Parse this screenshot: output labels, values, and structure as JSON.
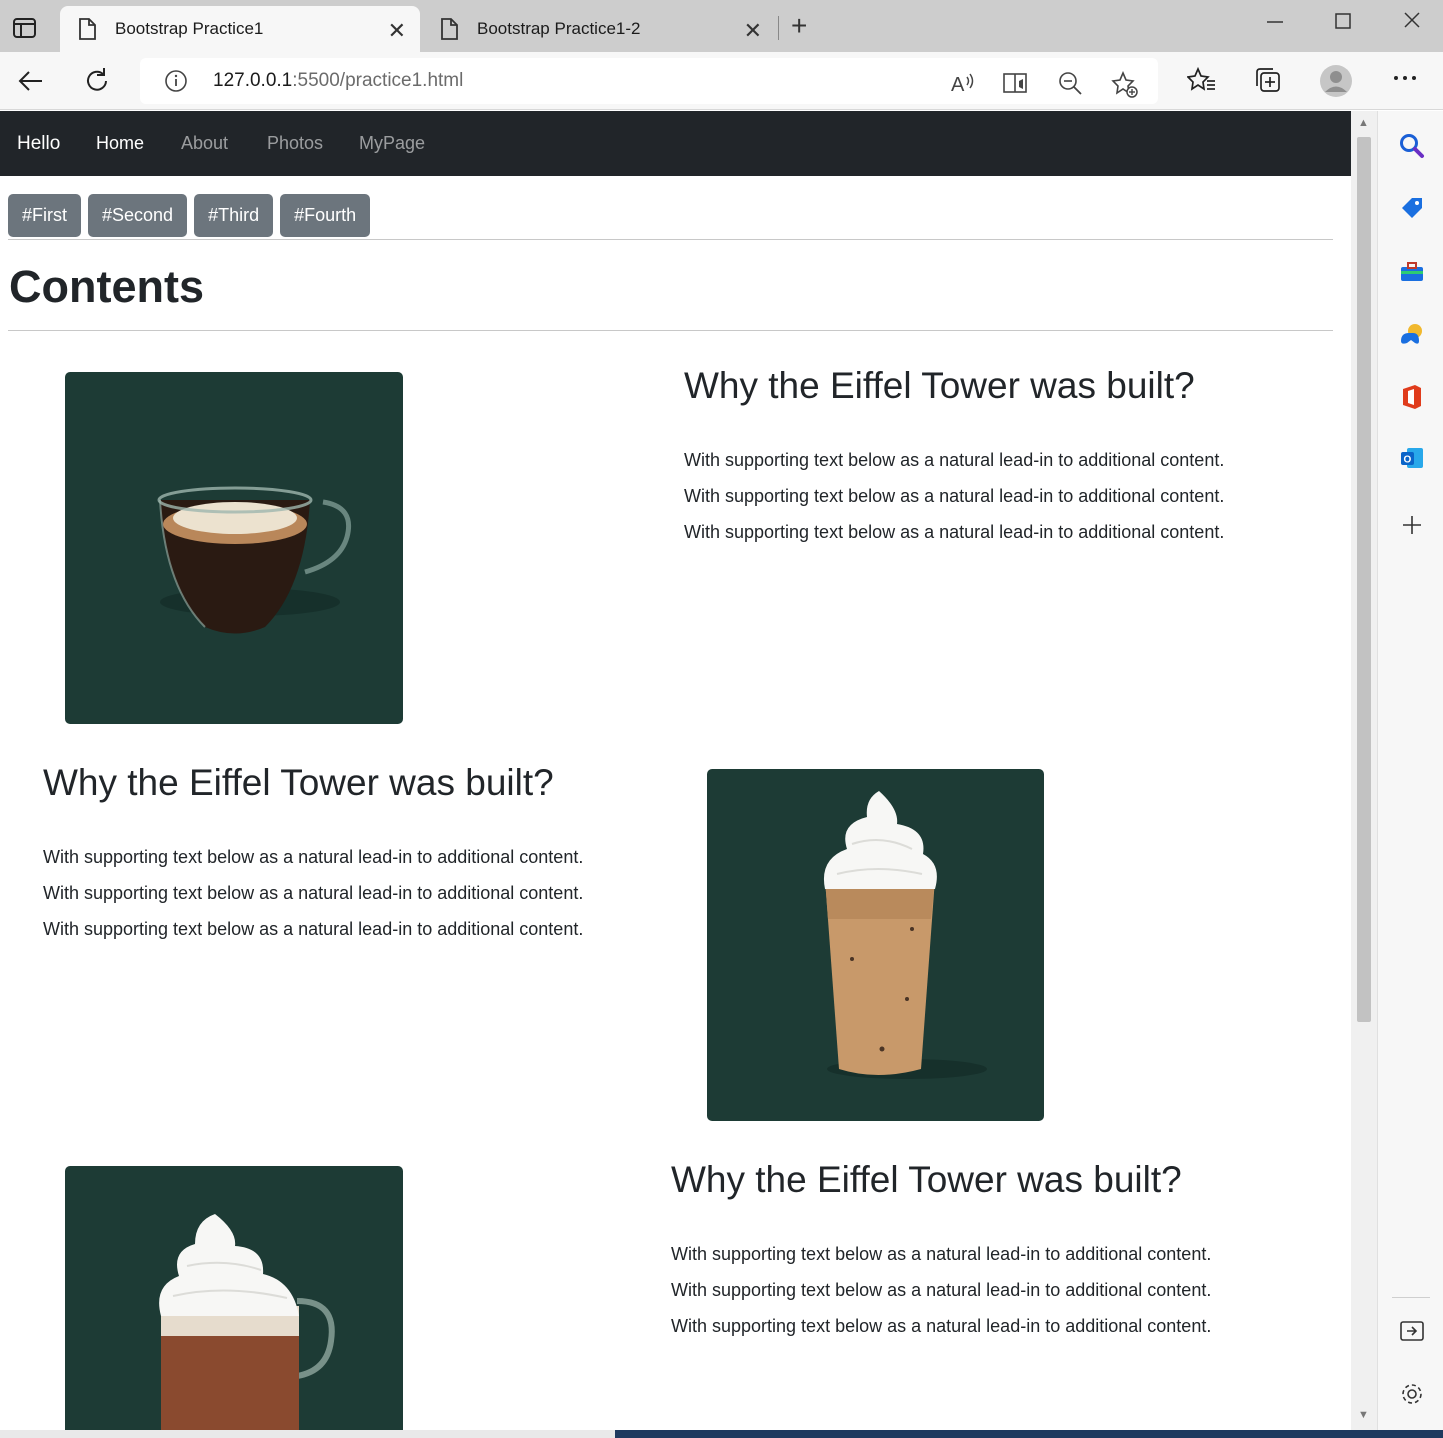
{
  "browser": {
    "tabs": [
      {
        "title": "Bootstrap Practice1",
        "active": true
      },
      {
        "title": "Bootstrap Practice1-2",
        "active": false
      }
    ],
    "url_host": "127.0.0.1",
    "url_rest": ":5500/practice1.html"
  },
  "navbar": {
    "brand": "Hello",
    "links": [
      "Home",
      "About",
      "Photos",
      "MyPage"
    ]
  },
  "buttons": [
    "#First",
    "#Second",
    "#Third",
    "#Fourth"
  ],
  "contents_title": "Contents",
  "sections": [
    {
      "heading": "Why the Eiffel Tower was built?",
      "lines": [
        "With supporting text below as a natural lead-in to additional content.",
        "With supporting text below as a natural lead-in to additional content.",
        "With supporting text below as a natural lead-in to additional content."
      ],
      "image": "hot-coffee-glass-cup"
    },
    {
      "heading": "Why the Eiffel Tower was built?",
      "lines": [
        "With supporting text below as a natural lead-in to additional content.",
        "With supporting text below as a natural lead-in to additional content.",
        "With supporting text below as a natural lead-in to additional content."
      ],
      "image": "iced-frappuccino-with-whipped-cream"
    },
    {
      "heading": "Why the Eiffel Tower was built?",
      "lines": [
        "With supporting text below as a natural lead-in to additional content.",
        "With supporting text below as a natural lead-in to additional content.",
        "With supporting text below as a natural lead-in to additional content."
      ],
      "image": "hot-chocolate-mug-with-whipped-cream"
    }
  ],
  "colors": {
    "navbar_bg": "#212529",
    "button_bg": "#6c757d",
    "photo_bg": "#1d3b35"
  }
}
